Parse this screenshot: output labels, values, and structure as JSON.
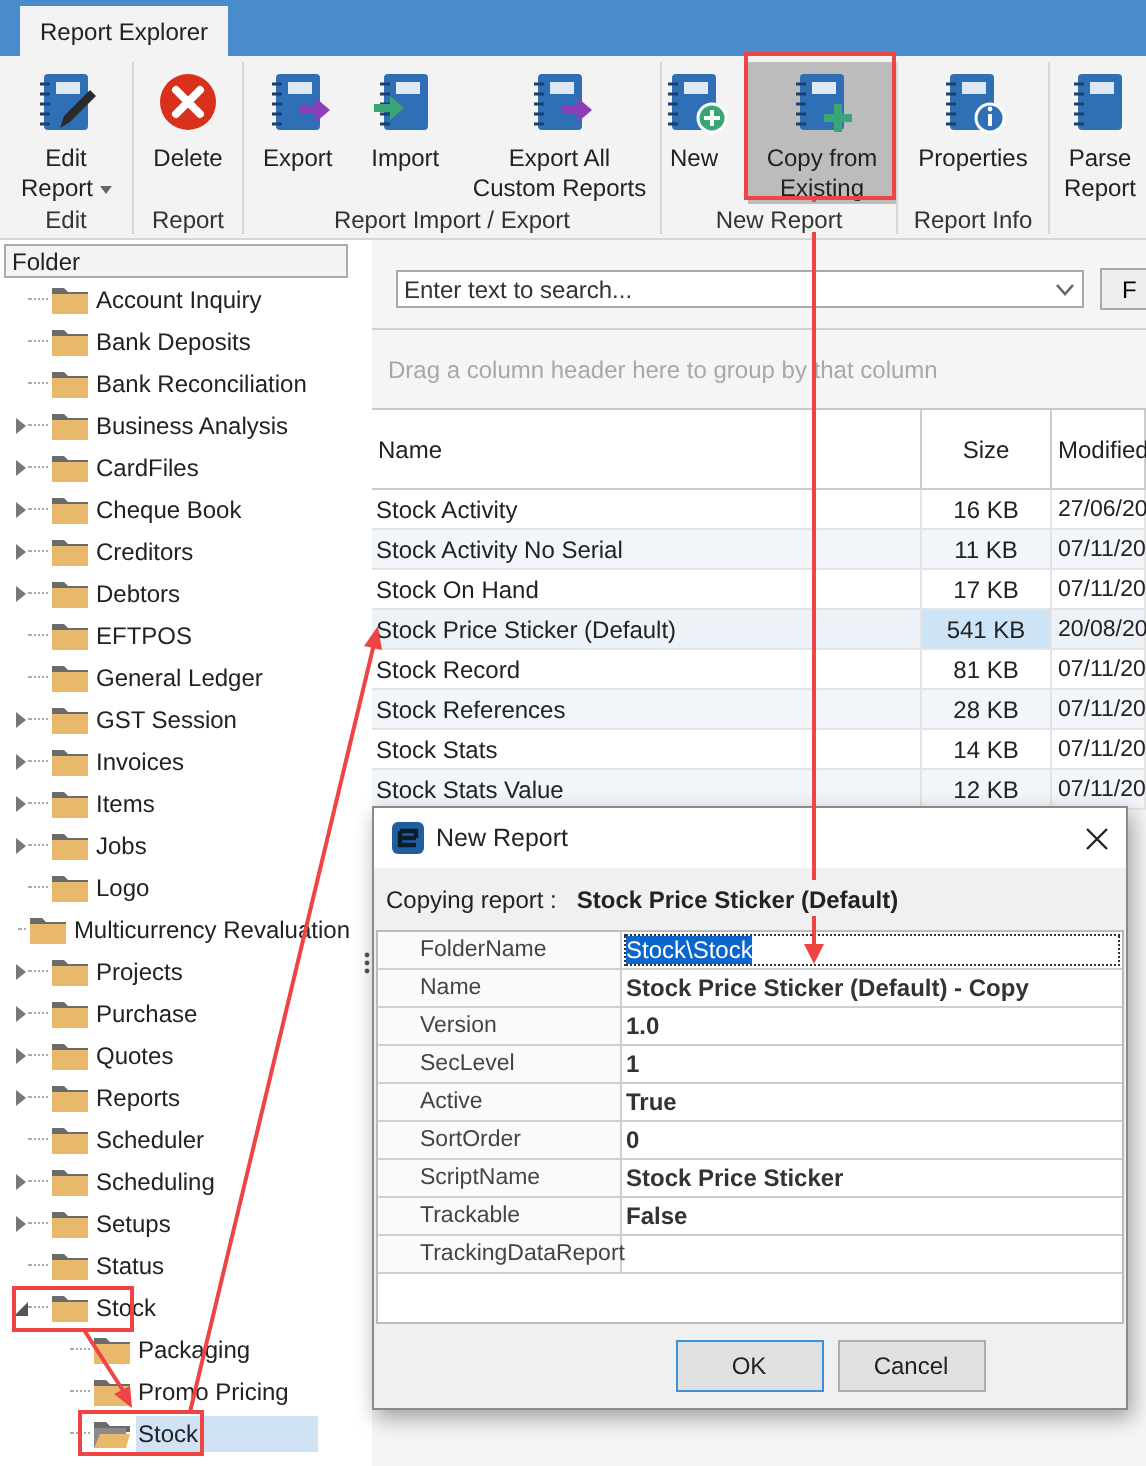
{
  "tabs": [
    {
      "label": "Report Explorer",
      "selected": true
    }
  ],
  "ribbon": {
    "groups": [
      {
        "label": "Edit",
        "buttons": [
          {
            "kind": "edit",
            "lines": [
              "Edit",
              "Report"
            ],
            "dropdown": true,
            "highlighted": false
          }
        ]
      },
      {
        "label": "Report",
        "buttons": [
          {
            "kind": "delete",
            "lines": [
              "Delete"
            ],
            "dropdown": false,
            "highlighted": false
          }
        ]
      },
      {
        "label": "Report Import / Export",
        "buttons": [
          {
            "kind": "export",
            "lines": [
              "Export"
            ],
            "dropdown": false,
            "highlighted": false
          },
          {
            "kind": "import",
            "lines": [
              "Import"
            ],
            "dropdown": false,
            "highlighted": false
          },
          {
            "kind": "export",
            "lines": [
              "Export All",
              "Custom Reports"
            ],
            "dropdown": false,
            "highlighted": false
          }
        ]
      },
      {
        "label": "New Report",
        "buttons": [
          {
            "kind": "new",
            "lines": [
              "New"
            ],
            "dropdown": false,
            "highlighted": false
          },
          {
            "kind": "copy",
            "lines": [
              "Copy from",
              "Existing"
            ],
            "dropdown": false,
            "highlighted": true
          }
        ]
      },
      {
        "label": "Report Info",
        "buttons": [
          {
            "kind": "info",
            "lines": [
              "Properties"
            ],
            "dropdown": false,
            "highlighted": false
          }
        ]
      },
      {
        "buttons": [
          {
            "kind": "plain",
            "lines": [
              "Parse",
              "Report"
            ],
            "dropdown": false,
            "highlighted": false
          }
        ]
      }
    ]
  },
  "folder_panel": {
    "header": "Folder",
    "tree": [
      {
        "label": "Account Inquiry",
        "selected": false
      },
      {
        "label": "Bank Deposits",
        "selected": false
      },
      {
        "label": "Bank Reconciliation",
        "selected": false
      },
      {
        "label": "Business Analysis",
        "expanded": false,
        "selected": false
      },
      {
        "label": "CardFiles",
        "expanded": false,
        "selected": false
      },
      {
        "label": "Cheque Book",
        "expanded": false,
        "selected": false
      },
      {
        "label": "Creditors",
        "expanded": false,
        "selected": false
      },
      {
        "label": "Debtors",
        "expanded": false,
        "selected": false
      },
      {
        "label": "EFTPOS",
        "selected": false
      },
      {
        "label": "General Ledger",
        "selected": false
      },
      {
        "label": "GST Session",
        "expanded": false,
        "selected": false
      },
      {
        "label": "Invoices",
        "expanded": false,
        "selected": false
      },
      {
        "label": "Items",
        "expanded": false,
        "selected": false
      },
      {
        "label": "Jobs",
        "expanded": false,
        "selected": false
      },
      {
        "label": "Logo",
        "selected": false
      },
      {
        "label": "Multicurrency Revaluation",
        "selected": false
      },
      {
        "label": "Projects",
        "expanded": false,
        "selected": false
      },
      {
        "label": "Purchase",
        "expanded": false,
        "selected": false
      },
      {
        "label": "Quotes",
        "expanded": false,
        "selected": false
      },
      {
        "label": "Reports",
        "expanded": false,
        "selected": false
      },
      {
        "label": "Scheduler",
        "selected": false
      },
      {
        "label": "Scheduling",
        "expanded": false,
        "selected": false
      },
      {
        "label": "Setups",
        "expanded": false,
        "selected": false
      },
      {
        "label": "Status",
        "selected": false
      },
      {
        "label": "Stock",
        "expanded": true,
        "selected": false,
        "children": [
          {
            "label": "Packaging",
            "selected": false
          },
          {
            "label": "Promo Pricing",
            "selected": false
          },
          {
            "label": "Stock",
            "selected": true
          }
        ]
      }
    ]
  },
  "search": {
    "placeholder": "Enter text to search...",
    "button": "F"
  },
  "group_panel": {
    "hint": "Drag a column header here to group by that column"
  },
  "table": {
    "columns": [
      "Name",
      "Size",
      "Modified"
    ],
    "rows": [
      {
        "name": "Stock Activity",
        "size": "16 KB",
        "modified": "27/06/20",
        "selected": false
      },
      {
        "name": "Stock Activity No Serial",
        "size": "11 KB",
        "modified": "07/11/20",
        "selected": false
      },
      {
        "name": "Stock On Hand",
        "size": "17 KB",
        "modified": "07/11/20",
        "selected": false
      },
      {
        "name": "Stock Price Sticker (Default)",
        "size": "541 KB",
        "modified": "20/08/20",
        "selected": true
      },
      {
        "name": "Stock Record",
        "size": "81 KB",
        "modified": "07/11/20",
        "selected": false
      },
      {
        "name": "Stock References",
        "size": "28 KB",
        "modified": "07/11/20",
        "selected": false
      },
      {
        "name": "Stock Stats",
        "size": "14 KB",
        "modified": "07/11/20",
        "selected": false
      },
      {
        "name": "Stock Stats Value",
        "size": "12 KB",
        "modified": "07/11/20",
        "selected": false
      }
    ]
  },
  "dialog": {
    "title": "New Report",
    "copying_label": "Copying report :",
    "copying_value": "Stock Price Sticker (Default)",
    "properties": [
      {
        "label": "FolderName",
        "value": "Stock\\Stock",
        "selected": true
      },
      {
        "label": "Name",
        "value": "Stock Price Sticker (Default) - Copy",
        "selected": false
      },
      {
        "label": "Version",
        "value": "1.0",
        "selected": false
      },
      {
        "label": "SecLevel",
        "value": "1",
        "selected": false
      },
      {
        "label": "Active",
        "value": "True",
        "selected": false
      },
      {
        "label": "SortOrder",
        "value": "0",
        "selected": false
      },
      {
        "label": "ScriptName",
        "value": "Stock Price Sticker",
        "selected": false
      },
      {
        "label": "Trackable",
        "value": "False",
        "selected": false
      },
      {
        "label": "TrackingDataReport",
        "selected": false
      }
    ],
    "buttons": [
      {
        "label": "OK",
        "default": true
      },
      {
        "label": "Cancel",
        "default": false
      }
    ]
  }
}
